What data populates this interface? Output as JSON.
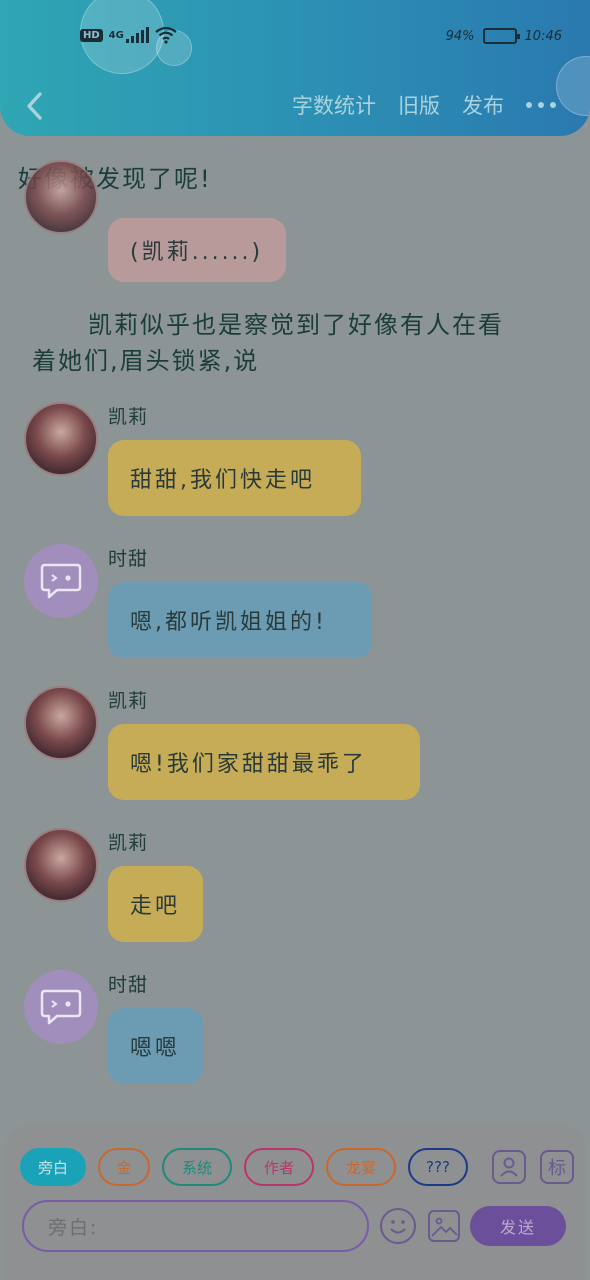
{
  "status_bar": {
    "hd": "HD",
    "network": "4G",
    "battery": "94%",
    "time": "10:46",
    "battery_level": 0.94
  },
  "nav": {
    "actions": [
      "字数统计",
      "旧版",
      "发布"
    ]
  },
  "story": {
    "narration_top": "好像被发现了呢!",
    "partial_bubble": "(凯莉......)",
    "narration_mid_1": "凯莉似乎也是察觉到了好像有人在看",
    "narration_mid_2": "着她们,眉头锁紧,说",
    "messages": [
      {
        "speaker": "凯莉",
        "text": "甜甜,我们快走吧",
        "color": "yellow"
      },
      {
        "speaker": "时甜",
        "text": "嗯,都听凯姐姐的!",
        "color": "blue"
      },
      {
        "speaker": "凯莉",
        "text": "嗯!我们家甜甜最乖了",
        "color": "yellow"
      },
      {
        "speaker": "凯莉",
        "text": "走吧",
        "color": "yellow"
      },
      {
        "speaker": "时甜",
        "text": "嗯嗯",
        "color": "blue"
      }
    ]
  },
  "toolbar": {
    "roles": [
      {
        "label": "旁白",
        "color": "#1aa3b8",
        "filled": true
      },
      {
        "label": "金",
        "color": "#c7692f",
        "filled": false
      },
      {
        "label": "系统",
        "color": "#1f8a7a",
        "filled": false
      },
      {
        "label": "作者",
        "color": "#b8366c",
        "filled": false
      },
      {
        "label": "龙宴",
        "color": "#c7692f",
        "filled": false
      },
      {
        "label": "???",
        "color": "#1b3a8a",
        "filled": false
      }
    ],
    "input_placeholder": "旁白:",
    "send_label": "发送",
    "mark_label": "标"
  },
  "colors": {
    "header_start": "#2fa6b3",
    "header_end": "#2a79b0",
    "bubble_yellow": "#c7ac57",
    "bubble_blue": "#6b9cb3",
    "send_purple": "#6c4f9b"
  }
}
